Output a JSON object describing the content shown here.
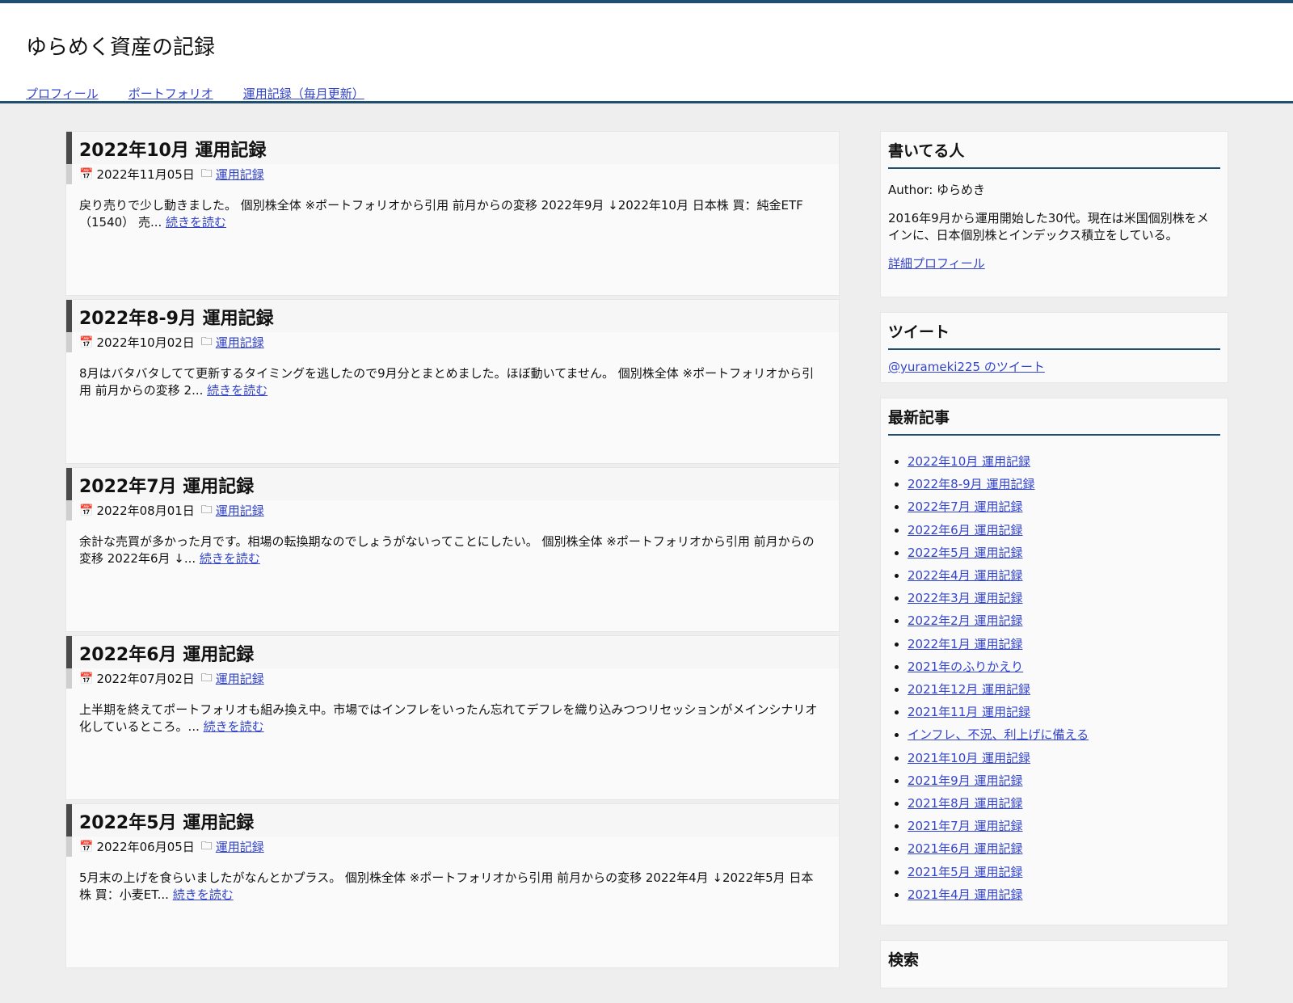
{
  "site": {
    "title": "ゆらめく資産の記録",
    "nav": [
      "プロフィール",
      "ポートフォリオ",
      "運用記録（毎月更新）"
    ]
  },
  "posts": [
    {
      "title": "2022年10月 運用記録",
      "date": "2022年11月05日",
      "category": "運用記録",
      "excerpt": "戻り売りで少し動きました。 個別株全体 ※ポートフォリオから引用 前月からの変移 2022年9月 ↓2022年10月 日本株 買：純金ETF（1540） 売...",
      "more": "続きを読む"
    },
    {
      "title": "2022年8-9月 運用記録",
      "date": "2022年10月02日",
      "category": "運用記録",
      "excerpt": "8月はバタバタしてて更新するタイミングを逃したので9月分とまとめました。ほぼ動いてません。 個別株全体 ※ポートフォリオから引用 前月からの変移 2...",
      "more": "続きを読む"
    },
    {
      "title": "2022年7月 運用記録",
      "date": "2022年08月01日",
      "category": "運用記録",
      "excerpt": "余計な売買が多かった月です。相場の転換期なのでしょうがないってことにしたい。 個別株全体 ※ポートフォリオから引用 前月からの変移 2022年6月 ↓...",
      "more": "続きを読む"
    },
    {
      "title": "2022年6月 運用記録",
      "date": "2022年07月02日",
      "category": "運用記録",
      "excerpt": "上半期を終えてポートフォリオも組み換え中。市場ではインフレをいったん忘れてデフレを織り込みつつリセッションがメインシナリオ化しているところ。...",
      "more": "続きを読む"
    },
    {
      "title": "2022年5月 運用記録",
      "date": "2022年06月05日",
      "category": "運用記録",
      "excerpt": "5月末の上げを食らいましたがなんとかプラス。 個別株全体 ※ポートフォリオから引用 前月からの変移 2022年4月 ↓2022年5月 日本株 買：小麦ET...",
      "more": "続きを読む"
    }
  ],
  "sidebar": {
    "author": {
      "title": "書いてる人",
      "name": "Author: ゆらめき",
      "bio": "2016年9月から運用開始した30代。現在は米国個別株をメインに、日本個別株とインデックス積立をしている。",
      "link": "詳細プロフィール"
    },
    "tweet": {
      "title": "ツイート",
      "link": "@yurameki225 のツイート"
    },
    "recent": {
      "title": "最新記事",
      "items": [
        "2022年10月 運用記録",
        "2022年8-9月 運用記録",
        "2022年7月 運用記録",
        "2022年6月 運用記録",
        "2022年5月 運用記録",
        "2022年4月 運用記録",
        "2022年3月 運用記録",
        "2022年2月 運用記録",
        "2022年1月 運用記録",
        "2021年のふりかえり",
        "2021年12月 運用記録",
        "2021年11月 運用記録",
        "インフレ、不況、利上げに備える",
        "2021年10月 運用記録",
        "2021年9月 運用記録",
        "2021年8月 運用記録",
        "2021年7月 運用記録",
        "2021年6月 運用記録",
        "2021年5月 運用記録",
        "2021年4月 運用記録"
      ]
    },
    "search": {
      "title": "検索"
    }
  },
  "icons": {
    "calendar": "calendar-icon",
    "folder": "folder-icon"
  },
  "colors": {
    "header_border": "#1f4e6e",
    "link": "#3344cc",
    "background": "#eeeeee"
  }
}
